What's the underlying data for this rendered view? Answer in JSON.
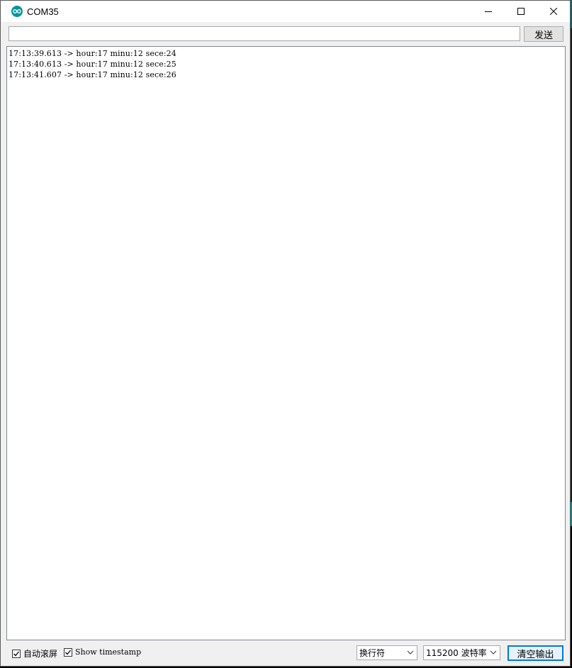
{
  "window": {
    "title": "COM35"
  },
  "send": {
    "input_value": "",
    "button_label": "发送"
  },
  "output": {
    "lines": [
      "17:13:39.613 -> hour:17 minu:12 sece:24",
      "17:13:40.613 -> hour:17 minu:12 sece:25",
      "17:13:41.607 -> hour:17 minu:12 sece:26"
    ]
  },
  "footer": {
    "autoscroll": {
      "label": "自动滚屏",
      "checked": true
    },
    "timestamp": {
      "label": "Show timestamp",
      "checked": true
    },
    "line_ending": {
      "value": "换行符"
    },
    "baud_rate": {
      "value": "115200 波特率"
    },
    "clear_button": "清空输出"
  },
  "colors": {
    "accent": "#0078d7",
    "app_icon": "#00979c"
  }
}
